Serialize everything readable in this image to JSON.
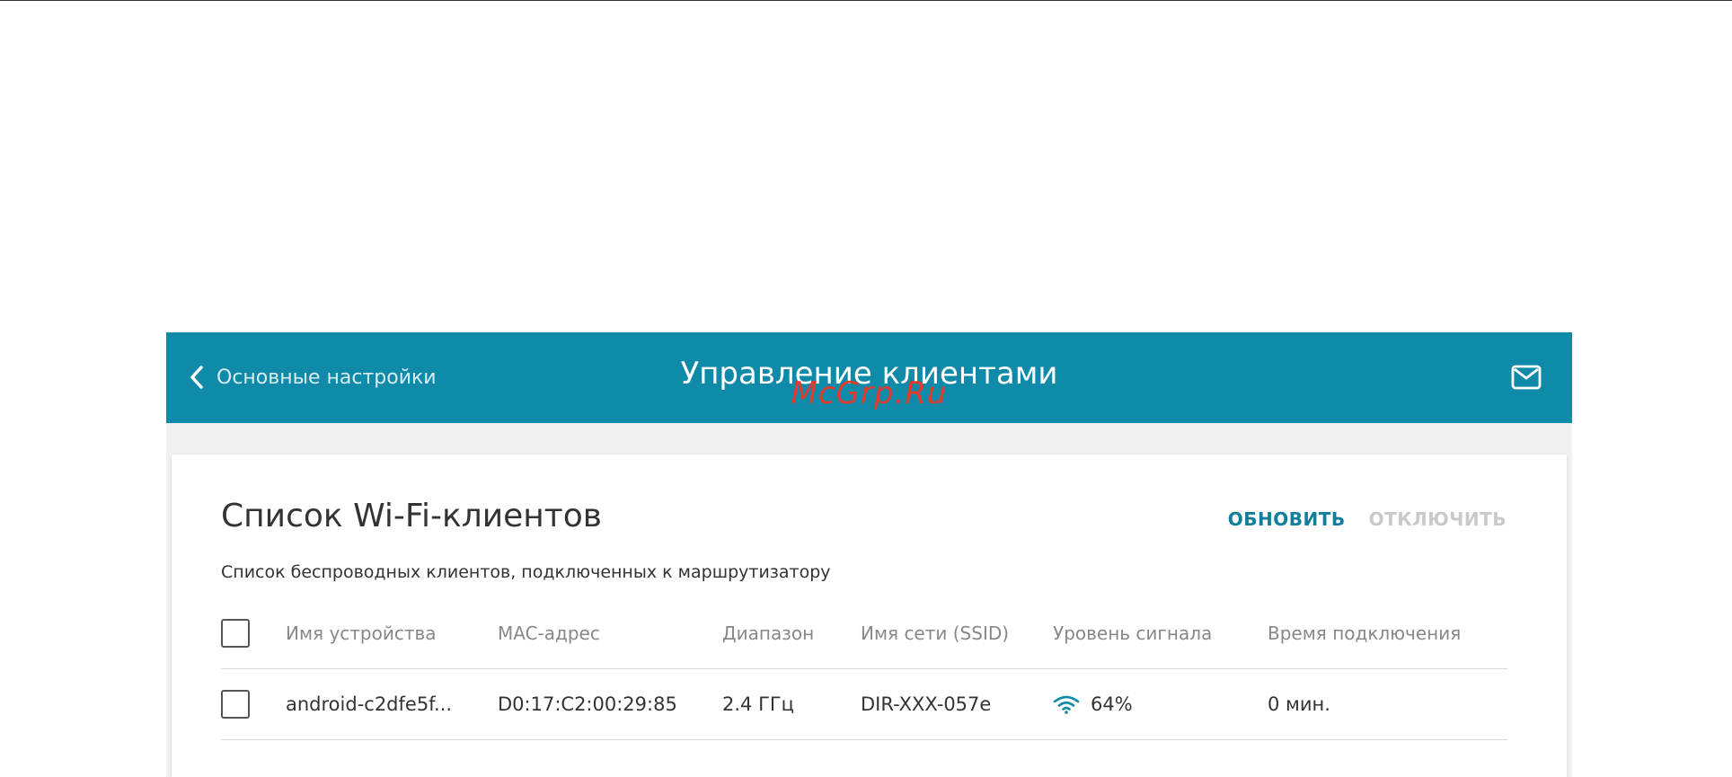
{
  "header": {
    "back_label": "Основные настройки",
    "title": "Управление клиентами",
    "watermark": "McGrp.Ru",
    "background_color": "#0f8aa8"
  },
  "card": {
    "title": "Список Wi-Fi-клиентов",
    "description": "Список беспроводных клиентов, подключенных к маршрутизатору",
    "actions": {
      "refresh_label": "ОБНОВИТЬ",
      "disconnect_label": "ОТКЛЮЧИТЬ"
    }
  },
  "table": {
    "columns": [
      "Имя устройства",
      "MAC-адрес",
      "Диапазон",
      "Имя сети (SSID)",
      "Уровень сигнала",
      "Время подключения"
    ],
    "rows": [
      {
        "device_name": "android-c2dfe5f...",
        "mac": "D0:17:C2:00:29:85",
        "band": "2.4 ГГц",
        "ssid": "DIR-XXX-057e",
        "signal": "64%",
        "connected_time": "0 мин."
      }
    ]
  },
  "icons": {
    "back": "chevron-left-icon",
    "mail": "mail-icon",
    "signal": "wifi-signal-icon"
  }
}
